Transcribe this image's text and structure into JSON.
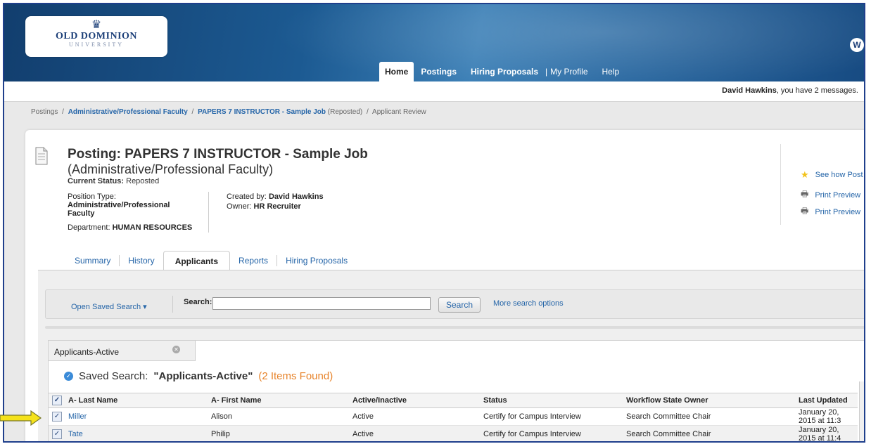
{
  "brand": {
    "logo_name": "OLD DOMINION",
    "logo_sub": "UNIVERSITY",
    "corner_initial": "W"
  },
  "nav": {
    "home": "Home",
    "postings": "Postings",
    "hiring_proposals": "Hiring Proposals",
    "separator": "|",
    "my_profile": "My Profile",
    "help": "Help"
  },
  "message_bar": {
    "user": "David Hawkins",
    "text": ", you have 2 messages."
  },
  "breadcrumb": {
    "root": "Postings",
    "level1": "Administrative/Professional Faculty",
    "level2": "PAPERS 7 INSTRUCTOR - Sample Job",
    "level2_suffix": "(Reposted)",
    "current": "Applicant Review",
    "sep": "/"
  },
  "posting": {
    "title": "Posting: PAPERS 7 INSTRUCTOR - Sample Job",
    "subtitle": "(Administrative/Professional Faculty)",
    "status_label": "Current Status:",
    "status_value": "Reposted",
    "position_type_label": "Position Type:",
    "position_type_value": "Administrative/Professional Faculty",
    "department_label": "Department:",
    "department_value": "HUMAN RESOURCES",
    "created_by_label": "Created by:",
    "created_by_value": "David Hawkins",
    "owner_label": "Owner:",
    "owner_value": "HR Recruiter"
  },
  "side_links": {
    "see_how": "See how Post",
    "print_preview_1": "Print Preview",
    "print_preview_2": "Print Preview"
  },
  "tabs": [
    "Summary",
    "History",
    "Applicants",
    "Reports",
    "Hiring Proposals"
  ],
  "search": {
    "open_saved": "Open Saved Search ▾",
    "label": "Search:",
    "value": "",
    "button": "Search",
    "more_options": "More search options"
  },
  "results": {
    "tab_label": "Applicants-Active",
    "saved_prefix": "Saved Search:",
    "saved_name": "\"Applicants-Active\"",
    "found": "(2 Items Found)",
    "columns": [
      "A- Last Name",
      "A- First Name",
      "Active/Inactive",
      "Status",
      "Workflow State Owner",
      "Last Updated"
    ],
    "rows": [
      {
        "last": "Miller",
        "first": "Alison",
        "active": "Active",
        "status": "Certify for Campus Interview",
        "owner": "Search Committee Chair",
        "updated": "January 20, 2015 at 11:3"
      },
      {
        "last": "Tate",
        "first": "Philip",
        "active": "Active",
        "status": "Certify for Campus Interview",
        "owner": "Search Committee Chair",
        "updated": "January 20, 2015 at 11:4"
      }
    ]
  },
  "colors": {
    "header": "#1c5a92",
    "link": "#2565a8",
    "found_count": "#e7832a",
    "arrow": "#f5e21b"
  }
}
